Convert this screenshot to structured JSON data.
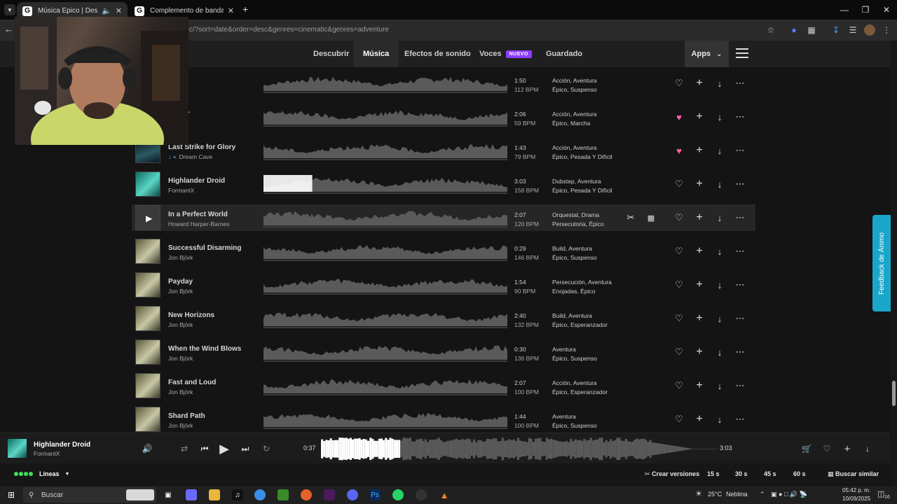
{
  "browser": {
    "tabs": [
      {
        "title": "Música Épico | Descarga sin",
        "active": true
      },
      {
        "title": "Complemento de bandas sono",
        "active": false
      }
    ],
    "url": "pic/?sort=date&order=desc&genres=cinematic&genres=adventure"
  },
  "nav": {
    "links": [
      "Descubrir",
      "Música",
      "Efectos de sonido",
      "Voces",
      "Guardado"
    ],
    "badge": "NUEVO",
    "apps": "Apps"
  },
  "tracks": [
    {
      "title": "e Up",
      "artist": "rk",
      "duration": "1:50",
      "bpm": "112 BPM",
      "genres1": "Acción, Aventura",
      "genres2": "Épico, Suspenso",
      "liked": false
    },
    {
      "title": "of War",
      "artist": "Cave",
      "duration": "2:06",
      "bpm": "59 BPM",
      "genres1": "Acción, Aventura",
      "genres2": "Épico, Marcha",
      "liked": true
    },
    {
      "title": "Last Strike for Glory",
      "artist": "Dream Cave",
      "duration": "1:43",
      "bpm": "79 BPM",
      "genres1": "Acción, Aventura",
      "genres2": "Épico, Pesada Y Difícil",
      "liked": true
    },
    {
      "title": "Highlander Droid",
      "artist": "FormantX",
      "duration": "3:03",
      "bpm": "158 BPM",
      "genres1": "Dubstep, Aventura",
      "genres2": "Épico, Pesada Y Difícil",
      "liked": false
    },
    {
      "title": "In a Perfect World",
      "artist": "Howard Harper-Barnes",
      "duration": "2:07",
      "bpm": "120 BPM",
      "genres1": "Orquestal, Drama",
      "genres2": "Persecutoria, Épico",
      "liked": false
    },
    {
      "title": "Successful Disarming",
      "artist": "Jon Björk",
      "duration": "0:29",
      "bpm": "146 BPM",
      "genres1": "Build, Aventura",
      "genres2": "Épico, Suspenso",
      "liked": false
    },
    {
      "title": "Payday",
      "artist": "Jon Björk",
      "duration": "1:54",
      "bpm": "90 BPM",
      "genres1": "Persecución, Aventura",
      "genres2": "Enojadas, Épico",
      "liked": false
    },
    {
      "title": "New Horizons",
      "artist": "Jon Björk",
      "duration": "2:40",
      "bpm": "132 BPM",
      "genres1": "Build, Aventura",
      "genres2": "Épico, Esperanzador",
      "liked": false
    },
    {
      "title": "When the Wind Blows",
      "artist": "Jon Björk",
      "duration": "0:30",
      "bpm": "136 BPM",
      "genres1": "Aventura",
      "genres2": "Épico, Suspenso",
      "liked": false
    },
    {
      "title": "Fast and Loud",
      "artist": "Jon Björk",
      "duration": "2:07",
      "bpm": "100 BPM",
      "genres1": "Acción, Aventura",
      "genres2": "Épico, Esperanzador",
      "liked": false
    },
    {
      "title": "Shard Path",
      "artist": "Jon Björk",
      "duration": "1:44",
      "bpm": "100 BPM",
      "genres1": "Aventura",
      "genres2": "Épico, Suspenso",
      "liked": false
    }
  ],
  "feedback": "Feedback de Ánimo",
  "player": {
    "title": "Highlander Droid",
    "artist": "FormantX",
    "current": "0:37",
    "total": "3:03",
    "progress": 0.2
  },
  "versions": {
    "lines": "Líneas",
    "create": "Crear versiones",
    "options": [
      "15 s",
      "30 s",
      "45 s",
      "60 s"
    ],
    "similar": "Buscar similar"
  },
  "taskbar": {
    "search": "Buscar",
    "weather": "25°C",
    "weather_desc": "Neblina",
    "time": "05:42 p. m.",
    "date": "10/09/2025",
    "notif": "16"
  },
  "colors": {
    "accent": "#8b3dff",
    "liked": "#ff5fa8",
    "feedback": "#1aa6c9",
    "lines_green": "#3ee05a"
  }
}
